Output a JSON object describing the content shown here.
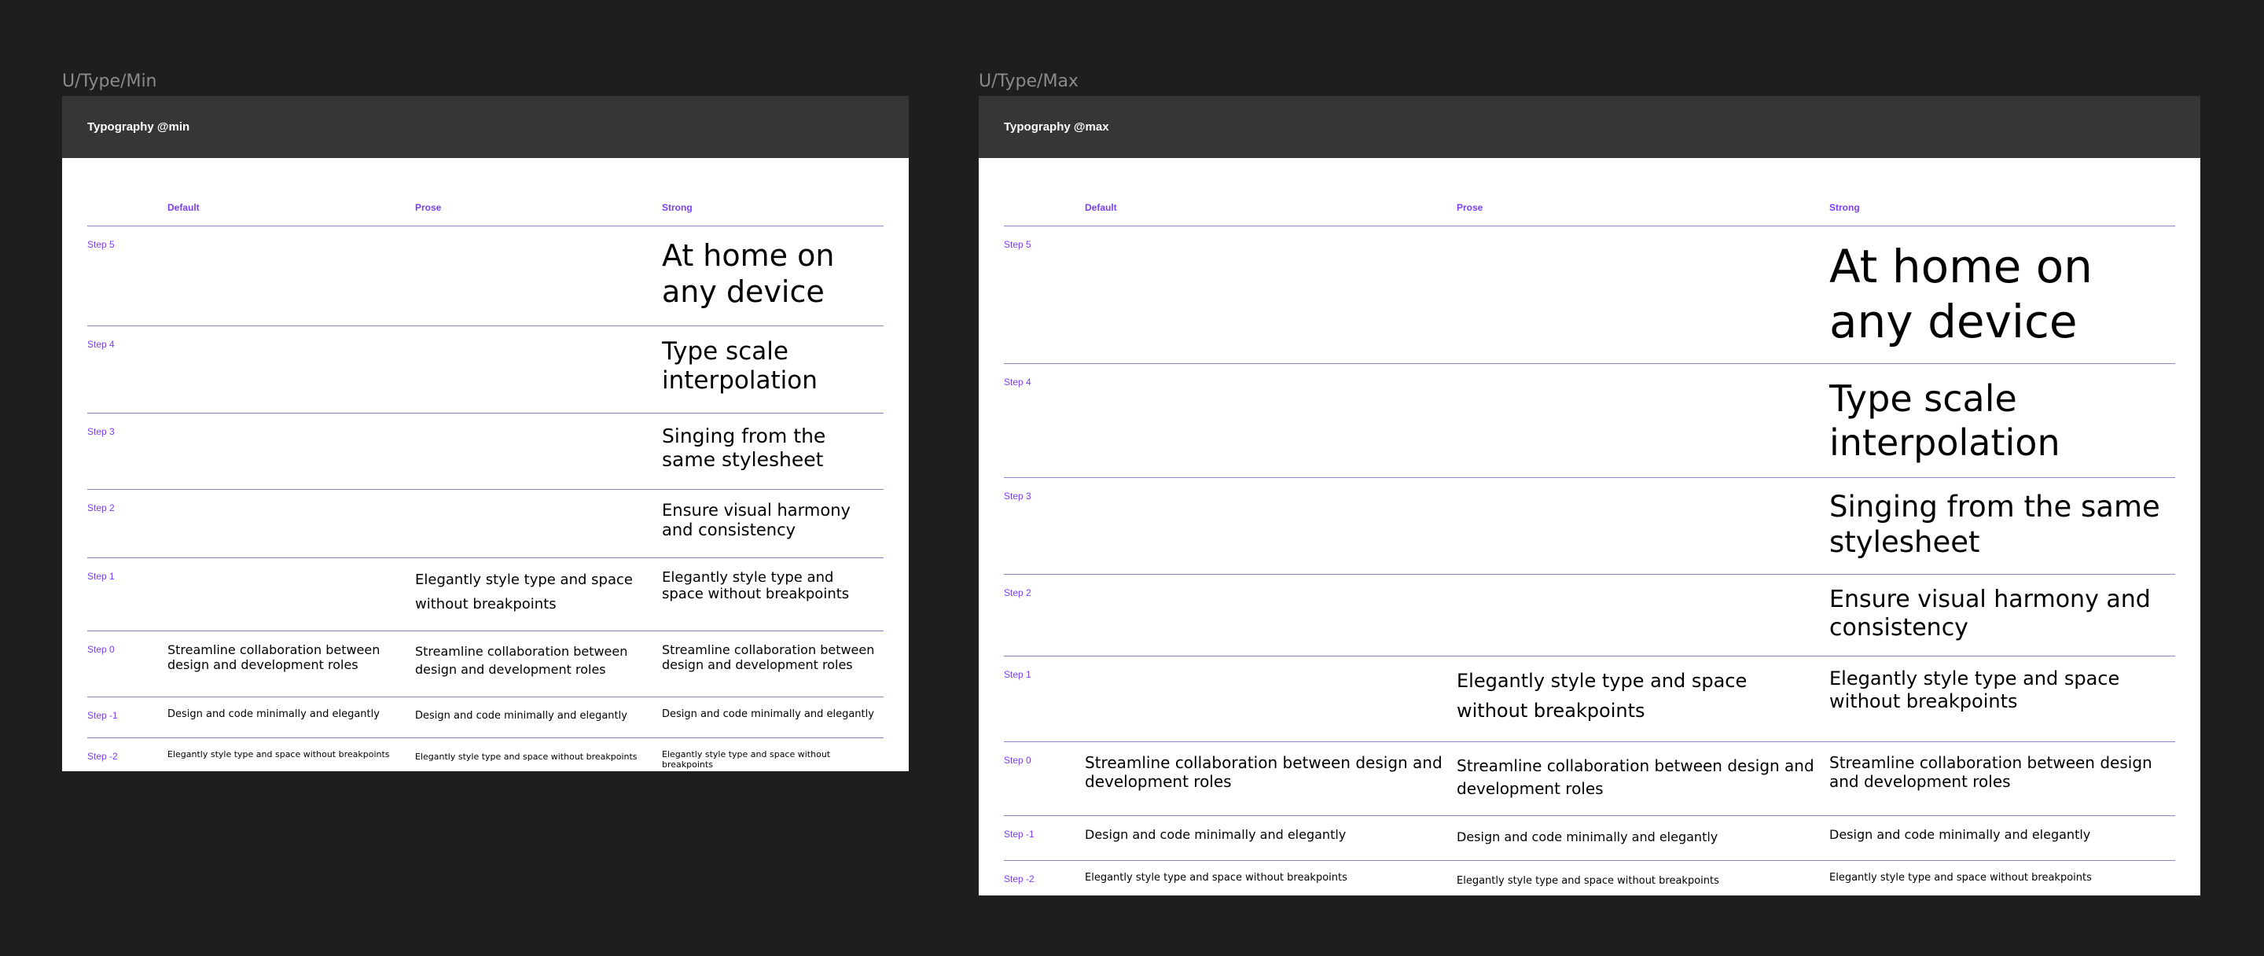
{
  "colors": {
    "canvas": "#1e1e1e",
    "header": "#363636",
    "accent": "#7b3ff2",
    "rule": "#8d88c6"
  },
  "frames": [
    {
      "label": "U/Type/Min",
      "header": "Typography @min",
      "columns": [
        "Default",
        "Prose",
        "Strong"
      ],
      "rows": [
        {
          "step": "Step 5",
          "default": "",
          "prose": "",
          "strong": "At home on any device"
        },
        {
          "step": "Step 4",
          "default": "",
          "prose": "",
          "strong": "Type scale interpolation"
        },
        {
          "step": "Step 3",
          "default": "",
          "prose": "",
          "strong": "Singing from the same stylesheet"
        },
        {
          "step": "Step 2",
          "default": "",
          "prose": "",
          "strong": "Ensure visual harmony and consistency"
        },
        {
          "step": "Step 1",
          "default": "",
          "prose": "Elegantly style type and space without breakpoints",
          "strong": "Elegantly style type and space without breakpoints"
        },
        {
          "step": "Step 0",
          "default": "Streamline collaboration between design and development roles",
          "prose": "Streamline collaboration between design and development roles",
          "strong": "Streamline collaboration between design and development roles"
        },
        {
          "step": "Step -1",
          "default": "Design and code minimally and elegantly",
          "prose": "Design and code minimally and elegantly",
          "strong": "Design and code minimally and elegantly"
        },
        {
          "step": "Step -2",
          "default": "Elegantly style type and space without breakpoints",
          "prose": "Elegantly style type and space without breakpoints",
          "strong": "Elegantly style type and space without breakpoints"
        }
      ]
    },
    {
      "label": "U/Type/Max",
      "header": "Typography @max",
      "columns": [
        "Default",
        "Prose",
        "Strong"
      ],
      "rows": [
        {
          "step": "Step 5",
          "default": "",
          "prose": "",
          "strong": "At home on any device"
        },
        {
          "step": "Step 4",
          "default": "",
          "prose": "",
          "strong": "Type scale interpolation"
        },
        {
          "step": "Step 3",
          "default": "",
          "prose": "",
          "strong": "Singing from the same stylesheet"
        },
        {
          "step": "Step 2",
          "default": "",
          "prose": "",
          "strong": "Ensure visual harmony and consistency"
        },
        {
          "step": "Step 1",
          "default": "",
          "prose": "Elegantly style type and space without breakpoints",
          "strong": "Elegantly style type and space without breakpoints"
        },
        {
          "step": "Step 0",
          "default": "Streamline collaboration between design and development roles",
          "prose": "Streamline collaboration between design and development roles",
          "strong": "Streamline collaboration between design and development roles"
        },
        {
          "step": "Step -1",
          "default": "Design and code minimally and elegantly",
          "prose": "Design and code minimally and elegantly",
          "strong": "Design and code minimally and elegantly"
        },
        {
          "step": "Step -2",
          "default": "Elegantly style type and space without breakpoints",
          "prose": "Elegantly style type and space without breakpoints",
          "strong": "Elegantly style type and space without breakpoints"
        }
      ]
    }
  ]
}
